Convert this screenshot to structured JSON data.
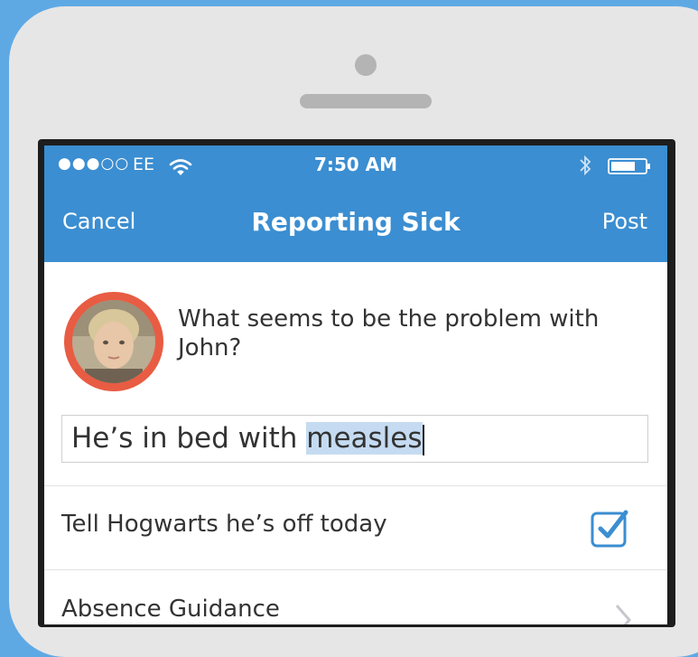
{
  "status_bar": {
    "signal": "●●●○○",
    "carrier": "EE",
    "time": "7:50 AM"
  },
  "nav": {
    "cancel_label": "Cancel",
    "title": "Reporting Sick",
    "post_label": "Post"
  },
  "prompt": {
    "question": "What seems to be the problem with John?"
  },
  "reply_input": {
    "value_before_selection": "He’s in bed with ",
    "selected_text": "measles"
  },
  "options": [
    {
      "label": "Tell Hogwarts he’s off today",
      "checked": true
    },
    {
      "label": "Absence Guidance"
    }
  ],
  "colors": {
    "background": "#5ea9e4",
    "nav_bar": "#3b8ed1",
    "avatar_ring": "#e85c43",
    "checkbox": "#3b8ed1"
  },
  "icons": [
    "wifi-icon",
    "bluetooth-icon",
    "battery-icon",
    "checkbox-checked-icon",
    "chevron-right-icon"
  ]
}
